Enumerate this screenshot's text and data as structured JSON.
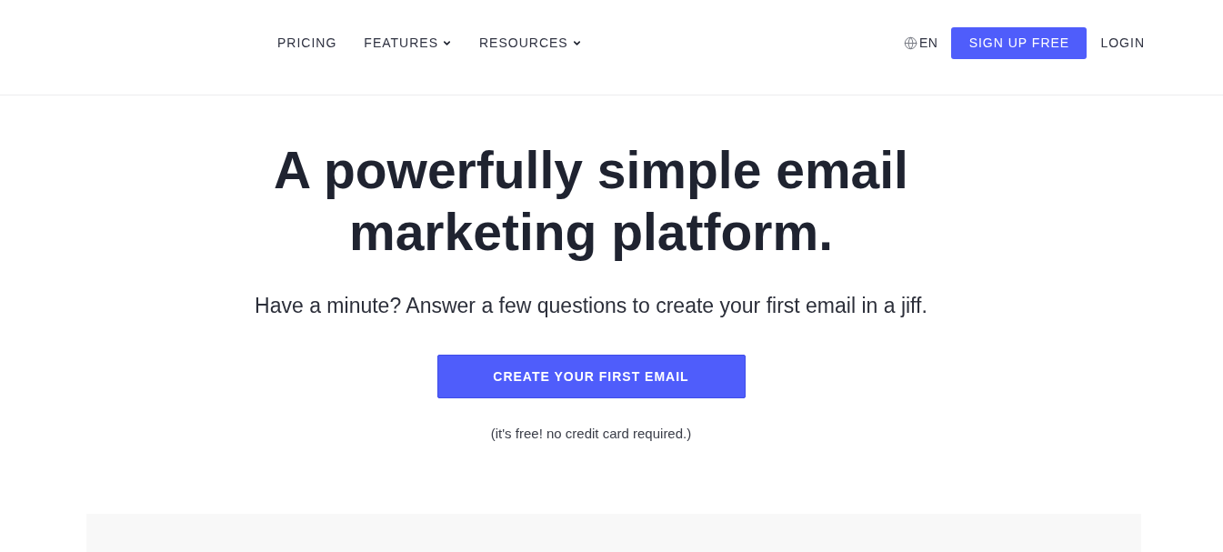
{
  "nav": {
    "links": [
      {
        "label": "PRICING",
        "kind": "link"
      },
      {
        "label": "FEATURES",
        "kind": "dropdown"
      },
      {
        "label": "RESOURCES",
        "kind": "dropdown"
      }
    ],
    "language": "EN",
    "signup": "SIGN UP FREE",
    "login": "LOGIN"
  },
  "hero": {
    "heading": "A powerfully simple email marketing platform.",
    "subtitle": "Have a minute? Answer a few questions to create your first email in a jiff.",
    "cta": "CREATE YOUR FIRST EMAIL",
    "note": "(it's free! no credit card required.)"
  }
}
